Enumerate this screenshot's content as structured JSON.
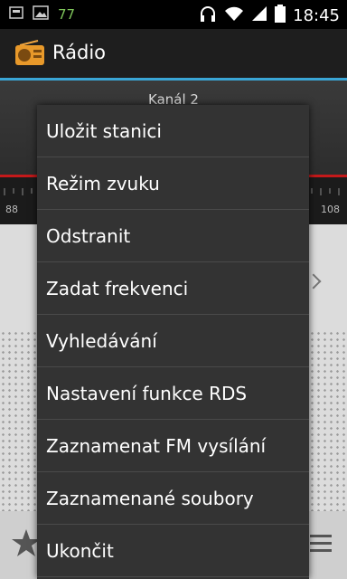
{
  "status_bar": {
    "notification_count": "77",
    "time": "18:45"
  },
  "app": {
    "title": "Rádio"
  },
  "tuner": {
    "channel": "Kanál 2",
    "scale_min": "88",
    "scale_max": "108"
  },
  "menu": {
    "items": [
      "Uložit stanici",
      "Režim zvuku",
      "Odstranit",
      "Zadat frekvenci",
      "Vyhledávání",
      "Nastavení funkce RDS",
      "Zaznamenat FM vysílání",
      "Zaznamenané soubory",
      "Ukončit"
    ]
  }
}
